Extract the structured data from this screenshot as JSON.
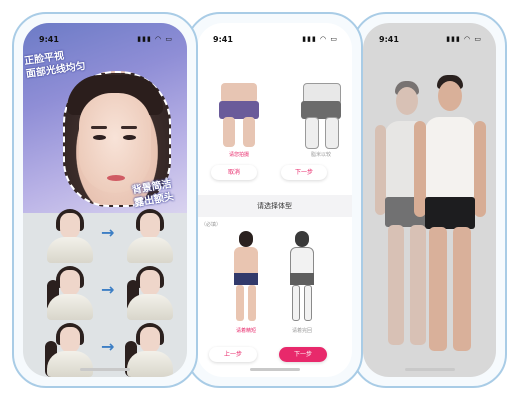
{
  "phone1": {
    "status_time": "9:41",
    "status_icons": "▮▮▮ ◠ ▭",
    "banner_tag_left_line1": "正脸平视",
    "banner_tag_left_line2": "面部光线均匀",
    "banner_tag_right_line1": "背景简洁",
    "banner_tag_right_line2": "露出额头",
    "arrow_glyph": "→"
  },
  "phone2": {
    "status_time": "9:41",
    "status_icons": "▮▮▮ ◠ ▭",
    "top_caption_left": "请您拍摄",
    "top_caption_right": "脂米以较",
    "top_btn_left": "取消",
    "top_btn_right": "下一步",
    "section_title": "请选择体型",
    "required_hint": "（必填）",
    "body_caption_left": "请着精短",
    "body_caption_right": "请着完回",
    "btn_prev": "上一步",
    "btn_next": "下一步"
  },
  "phone3": {
    "status_time": "9:41",
    "status_icons": "▮▮▮ ◠ ▭"
  }
}
